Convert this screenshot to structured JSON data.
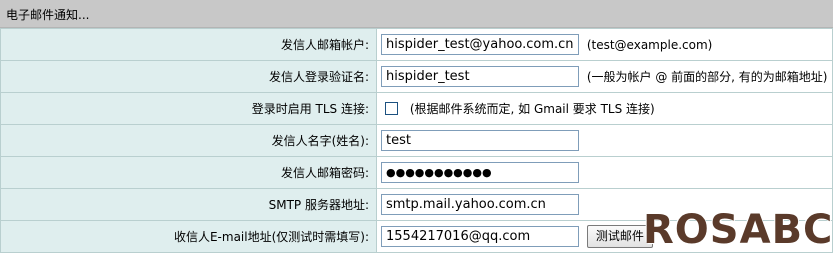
{
  "section": {
    "title": "电子邮件通知..."
  },
  "rows": [
    {
      "label": "发信人邮箱帐户:",
      "value": "hispider_test@yahoo.com.cn",
      "hint": "(test@example.com)"
    },
    {
      "label": "发信人登录验证名:",
      "value": "hispider_test",
      "hint": "(一般为帐户 @ 前面的部分, 有的为邮箱地址)"
    },
    {
      "label": "登录时启用 TLS 连接:",
      "checked": false,
      "hint": "(根据邮件系统而定, 如 Gmail 要求 TLS 连接)"
    },
    {
      "label": "发信人名字(姓名):",
      "value": "test"
    },
    {
      "label": "发信人邮箱密码:",
      "value": "●●●●●●●●●●●"
    },
    {
      "label": "SMTP 服务器地址:",
      "value": "smtp.mail.yahoo.com.cn"
    },
    {
      "label": "收信人E-mail地址(仅测试时需填写):",
      "value": "1554217016@qq.com",
      "button": "测试邮件"
    }
  ],
  "watermark": "ROSABC"
}
